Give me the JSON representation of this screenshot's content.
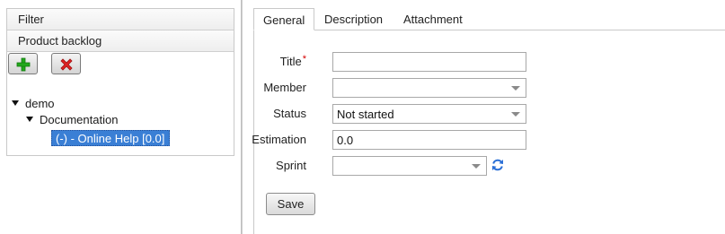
{
  "left_panel": {
    "accordion": [
      "Filter",
      "Product backlog"
    ],
    "toolbar": {
      "add_icon": "plus-icon",
      "delete_icon": "x-icon"
    },
    "tree": [
      {
        "label": "demo",
        "level": 0,
        "expanded": true
      },
      {
        "label": "Documentation",
        "level": 1,
        "expanded": true
      },
      {
        "label": "(-) - Online Help [0.0]",
        "level": 2,
        "selected": true
      }
    ]
  },
  "tabs": [
    "General",
    "Description",
    "Attachment"
  ],
  "active_tab": "General",
  "form": {
    "title_label": "Title",
    "required_marker": "*",
    "title_value": "",
    "member_label": "Member",
    "member_value": "",
    "status_label": "Status",
    "status_value": "Not started",
    "estimation_label": "Estimation",
    "estimation_value": "0.0",
    "sprint_label": "Sprint",
    "sprint_value": "",
    "refresh_icon": "refresh-icon",
    "save_label": "Save"
  },
  "colors": {
    "selection": "#3a7fd5",
    "required": "#d40000",
    "refresh": "#2a6fd6"
  }
}
